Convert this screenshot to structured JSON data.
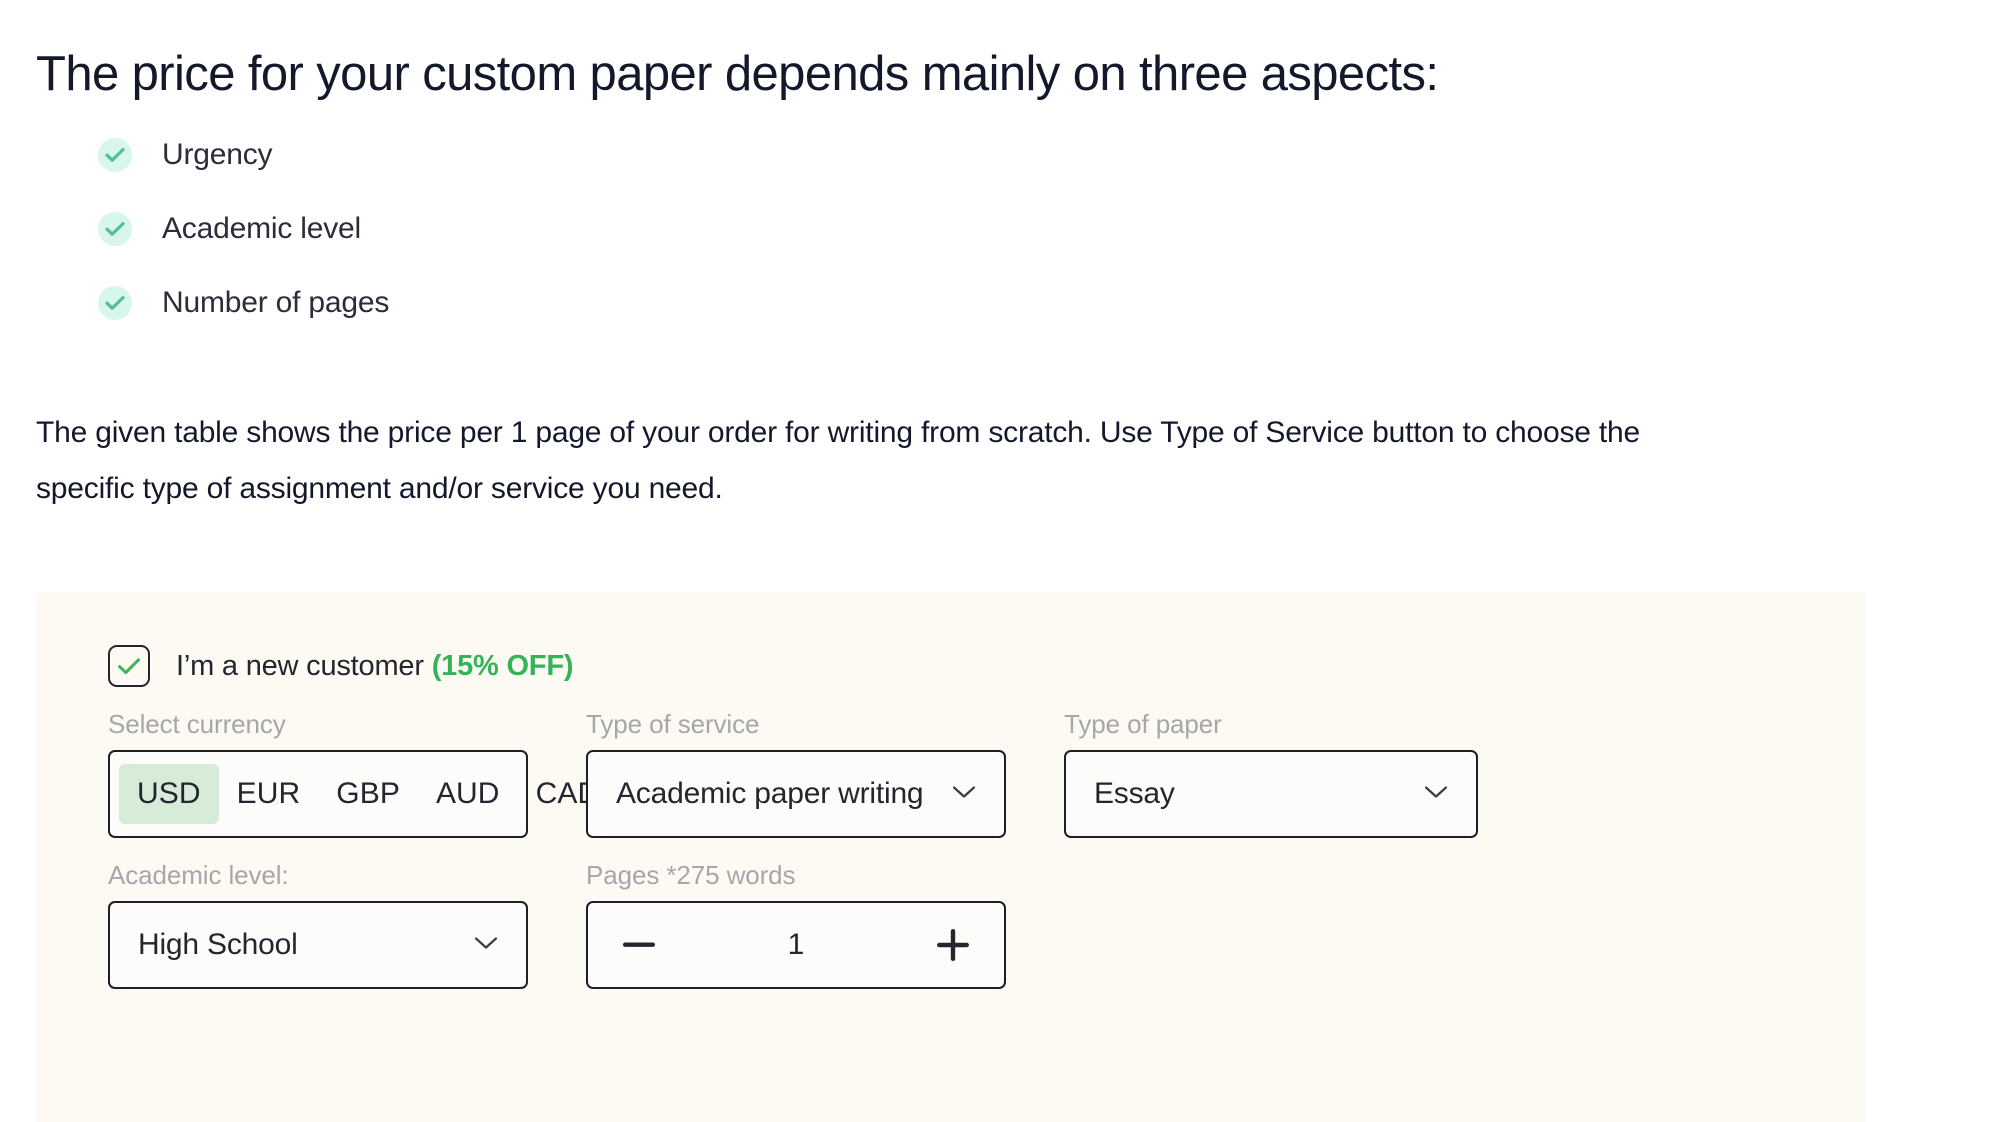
{
  "heading": "The price for your custom paper depends mainly on three aspects:",
  "checklist": [
    {
      "label": "Urgency",
      "icon": "check-icon"
    },
    {
      "label": "Academic level",
      "icon": "check-icon"
    },
    {
      "label": "Number of pages",
      "icon": "check-icon"
    }
  ],
  "paragraph": {
    "line1": "The given table shows the price per 1 page of your order for writing from scratch. Use Type of Service button to choose the",
    "line2": "specific type of assignment and/or service you need."
  },
  "calculator": {
    "new_customer": {
      "checked": true,
      "label": "I’m a new customer",
      "discount": "(15% OFF)",
      "discount_color": "#34b457"
    },
    "currency": {
      "label": "Select currency",
      "options": [
        "USD",
        "EUR",
        "GBP",
        "AUD",
        "CAD"
      ],
      "selected": "USD",
      "selected_bg": "#d6ecd9"
    },
    "type_of_service": {
      "label": "Type of service",
      "value": "Academic paper writing",
      "chevron": "chevron-down-icon"
    },
    "type_of_paper": {
      "label": "Type of paper",
      "value": "Essay",
      "chevron": "chevron-down-icon"
    },
    "academic_level": {
      "label": "Academic level:",
      "value": "High School",
      "chevron": "chevron-down-icon"
    },
    "pages": {
      "label": "Pages *275 words",
      "value": "1",
      "decrement_icon": "minus-icon",
      "increment_icon": "plus-icon"
    },
    "panel_bg": "#fdfaf3"
  }
}
